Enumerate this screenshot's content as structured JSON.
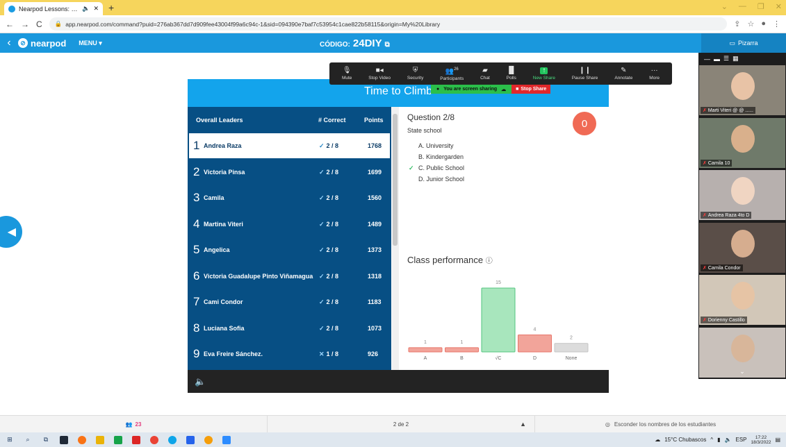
{
  "browser": {
    "tab_title": "Nearpod Lessons: Download",
    "url": "app.nearpod.com/command?puid=276ab367dd7d909fee43004f99a6c94c-1&sid=094390e7baf7c53954c1cae822b58115&origin=My%20Library"
  },
  "nearpod": {
    "logo_text": "nearpod",
    "menu_label": "MENU",
    "code_label": "CÓDIGO:",
    "code_value": "24DIY",
    "pizarra_label": "Pizarra",
    "content_title": "Time to Climb"
  },
  "zoom": {
    "participants_count": "26",
    "items": [
      {
        "label": "Mute",
        "icon": "microphone-icon"
      },
      {
        "label": "Stop Video",
        "icon": "video-camera-icon"
      },
      {
        "label": "Security",
        "icon": "shield-icon"
      },
      {
        "label": "Participants",
        "icon": "people-icon"
      },
      {
        "label": "Chat",
        "icon": "chat-icon"
      },
      {
        "label": "Polls",
        "icon": "bar-chart-icon"
      },
      {
        "label": "New Share",
        "icon": "share-arrow-icon"
      },
      {
        "label": "Pause Share",
        "icon": "pause-icon"
      },
      {
        "label": "Annotate",
        "icon": "pencil-icon"
      },
      {
        "label": "More",
        "icon": "ellipsis-icon"
      }
    ],
    "sharing_text": "You are screen sharing",
    "stop_share_label": "Stop Share"
  },
  "leaderboard": {
    "headers": {
      "leaders": "Overall Leaders",
      "correct": "# Correct",
      "points": "Points"
    },
    "rows": [
      {
        "rank": "1",
        "name": "Andrea Raza",
        "mark": "✓",
        "correct": "2 / 8",
        "points": "1768"
      },
      {
        "rank": "2",
        "name": "Victoria Pinsa",
        "mark": "✓",
        "correct": "2 / 8",
        "points": "1699"
      },
      {
        "rank": "3",
        "name": "Camila",
        "mark": "✓",
        "correct": "2 / 8",
        "points": "1560"
      },
      {
        "rank": "4",
        "name": "Martina Viteri",
        "mark": "✓",
        "correct": "2 / 8",
        "points": "1489"
      },
      {
        "rank": "5",
        "name": "Angelica",
        "mark": "✓",
        "correct": "2 / 8",
        "points": "1373"
      },
      {
        "rank": "6",
        "name": "Victoria Guadalupe Pinto Viñamagua",
        "mark": "✓",
        "correct": "2 / 8",
        "points": "1318"
      },
      {
        "rank": "7",
        "name": "Cami Condor",
        "mark": "✓",
        "correct": "2 / 8",
        "points": "1183"
      },
      {
        "rank": "8",
        "name": "Luciana Sofia",
        "mark": "✓",
        "correct": "2 / 8",
        "points": "1073"
      },
      {
        "rank": "9",
        "name": "Eva Freire Sánchez.",
        "mark": "✕",
        "correct": "1 / 8",
        "points": "926"
      }
    ]
  },
  "question": {
    "title": "Question 2/8",
    "prompt": "State school",
    "options": [
      "A. University",
      "B. Kindergarden",
      "C. Public School",
      "D. Junior School"
    ],
    "correct_index": 2,
    "badge": "0",
    "performance_title": "Class performance"
  },
  "chart_data": {
    "type": "bar",
    "categories": [
      "A",
      "B",
      "√C",
      "D",
      "None"
    ],
    "values": [
      1,
      1,
      15,
      4,
      2
    ],
    "colors": [
      "#f2a49a",
      "#f2a49a",
      "#a8e6bd",
      "#f2a49a",
      "#dcdcdc"
    ],
    "borders": [
      "#e8766a",
      "#e8766a",
      "#53c47f",
      "#e8766a",
      "#c4c4c4"
    ],
    "ylim": [
      0,
      15
    ]
  },
  "participants": [
    {
      "name": "Marti Viteri @ @ ......"
    },
    {
      "name": "Camila 10"
    },
    {
      "name": "Andrea Raza 4to D"
    },
    {
      "name": "Camila Condor"
    },
    {
      "name": "Dorienny Castillo"
    },
    {
      "name": ""
    }
  ],
  "status": {
    "student_count": "23",
    "page": "2 de 2",
    "hide_names": "Esconder los nombres de los estudiantes"
  },
  "taskbar": {
    "weather": "15°C  Chubascos",
    "lang": "ESP",
    "time": "17:22",
    "date": "18/3/2022"
  }
}
